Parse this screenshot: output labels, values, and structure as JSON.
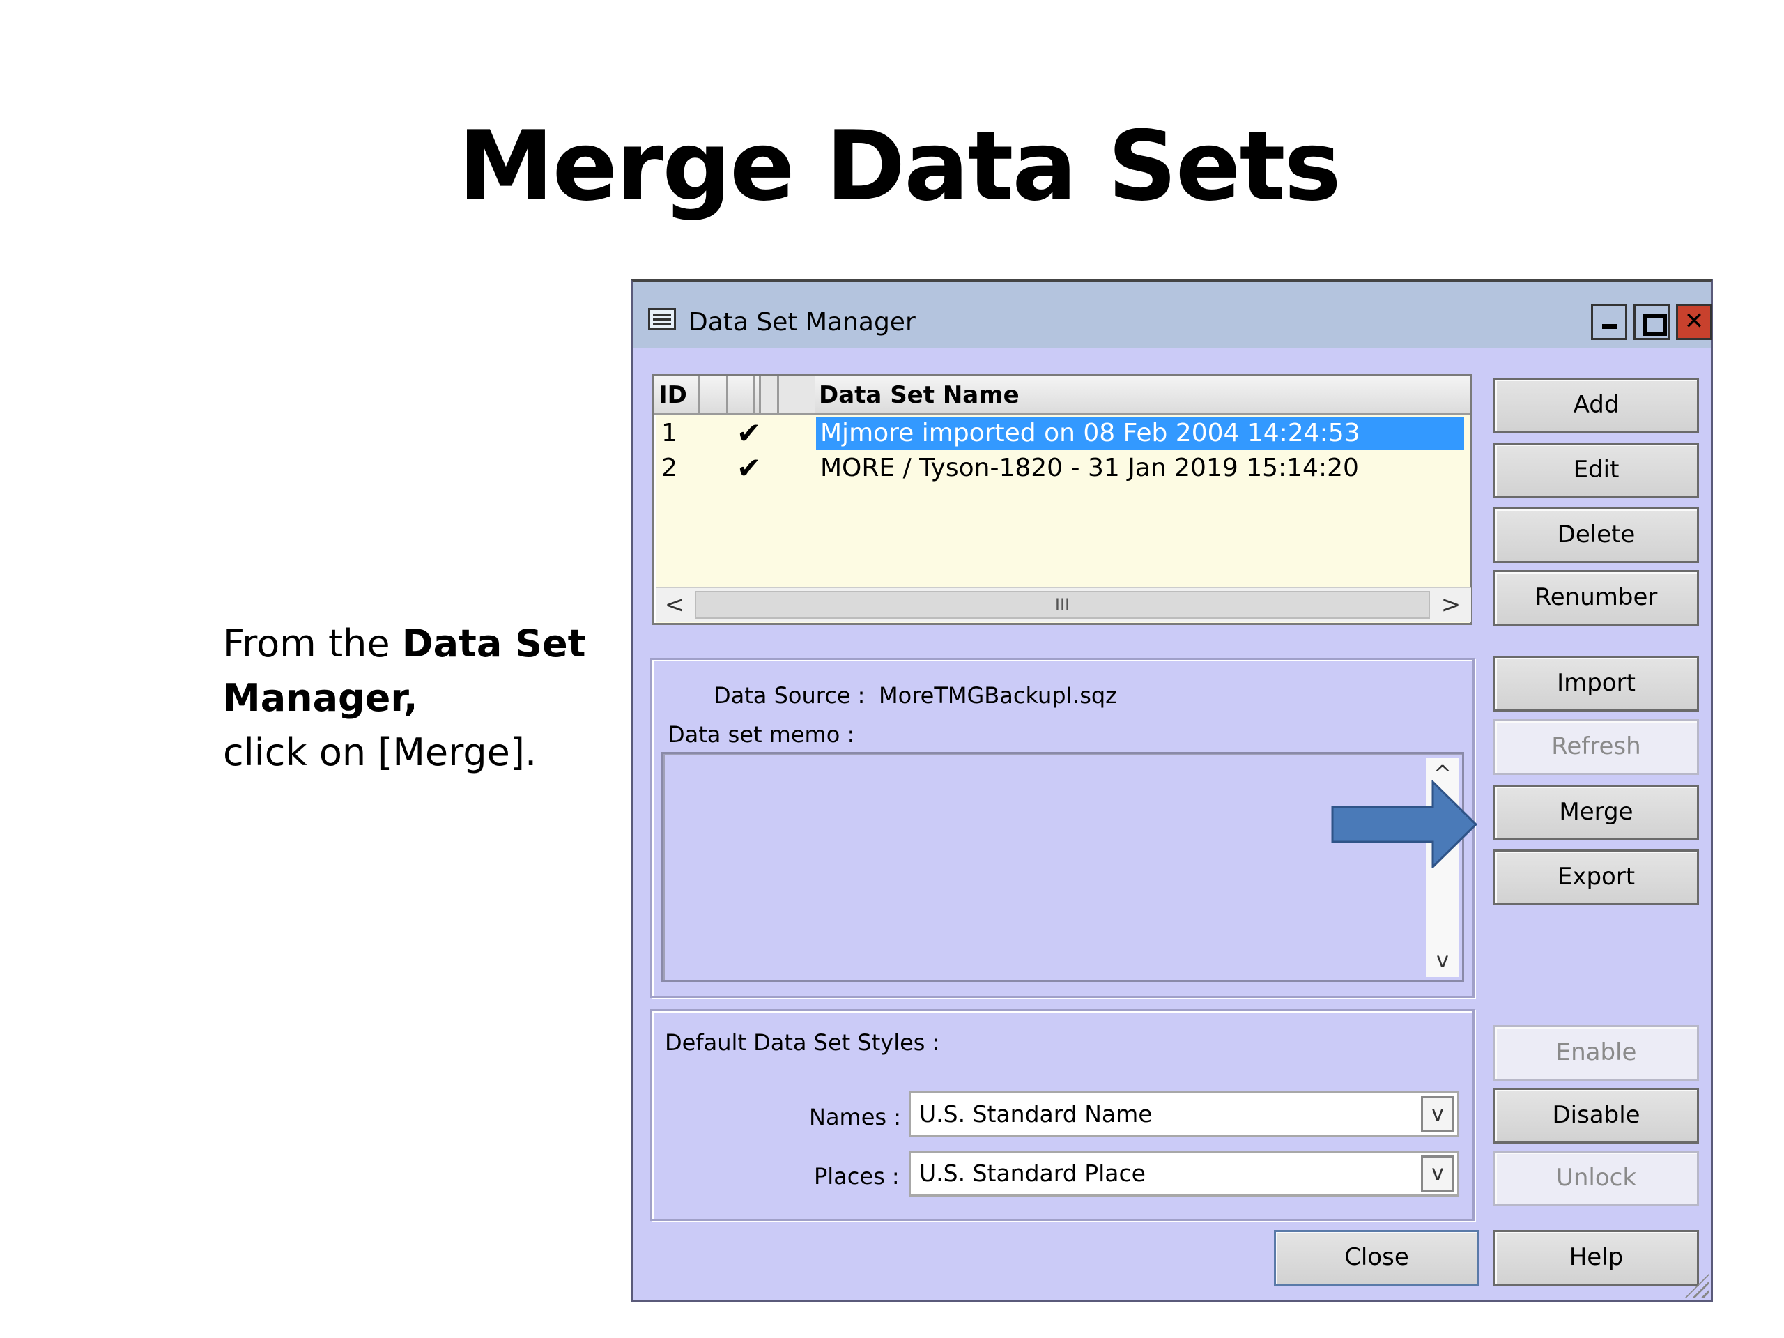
{
  "slide": {
    "title": "Merge Data Sets",
    "instruction_prefix": "From the ",
    "instruction_bold": "Data Set Manager,",
    "instruction_suffix": "click on [Merge]."
  },
  "window": {
    "title": "Data Set Manager",
    "close_glyph": "✕"
  },
  "grid": {
    "columns": [
      "ID",
      "",
      "",
      "Data Set Name"
    ],
    "rows": [
      {
        "id": "1",
        "check": "✔",
        "name": "Mjmore imported on 08 Feb 2004 14:24:53",
        "selected": true
      },
      {
        "id": "2",
        "check": "✔",
        "name": "MORE / Tyson-1820 - 31 Jan 2019 15:14:20",
        "selected": false
      }
    ],
    "scroll_left": "<",
    "scroll_right": ">",
    "scroll_thumb": "III"
  },
  "source": {
    "data_source_label": "Data Source :",
    "data_source_value": "MoreTMGBackupI.sqz",
    "memo_label": "Data set memo :",
    "scroll_up": "^",
    "scroll_down": "v"
  },
  "styles": {
    "group_label": "Default Data Set Styles :",
    "names_label": "Names :",
    "names_value": "U.S. Standard Name",
    "places_label": "Places :",
    "places_value": "U.S. Standard Place",
    "dropdown_glyph": "v"
  },
  "buttons": {
    "add": "Add",
    "edit": "Edit",
    "delete": "Delete",
    "renumber": "Renumber",
    "import": "Import",
    "refresh": "Refresh",
    "merge": "Merge",
    "export": "Export",
    "enable": "Enable",
    "disable": "Disable",
    "unlock": "Unlock",
    "close": "Close",
    "help": "Help"
  },
  "colors": {
    "window_bg": "#cbcbf7",
    "titlebar": "#b4c4de",
    "selection": "#3399ff",
    "arrow": "#4a7ab8",
    "close_button": "#c8412d"
  }
}
